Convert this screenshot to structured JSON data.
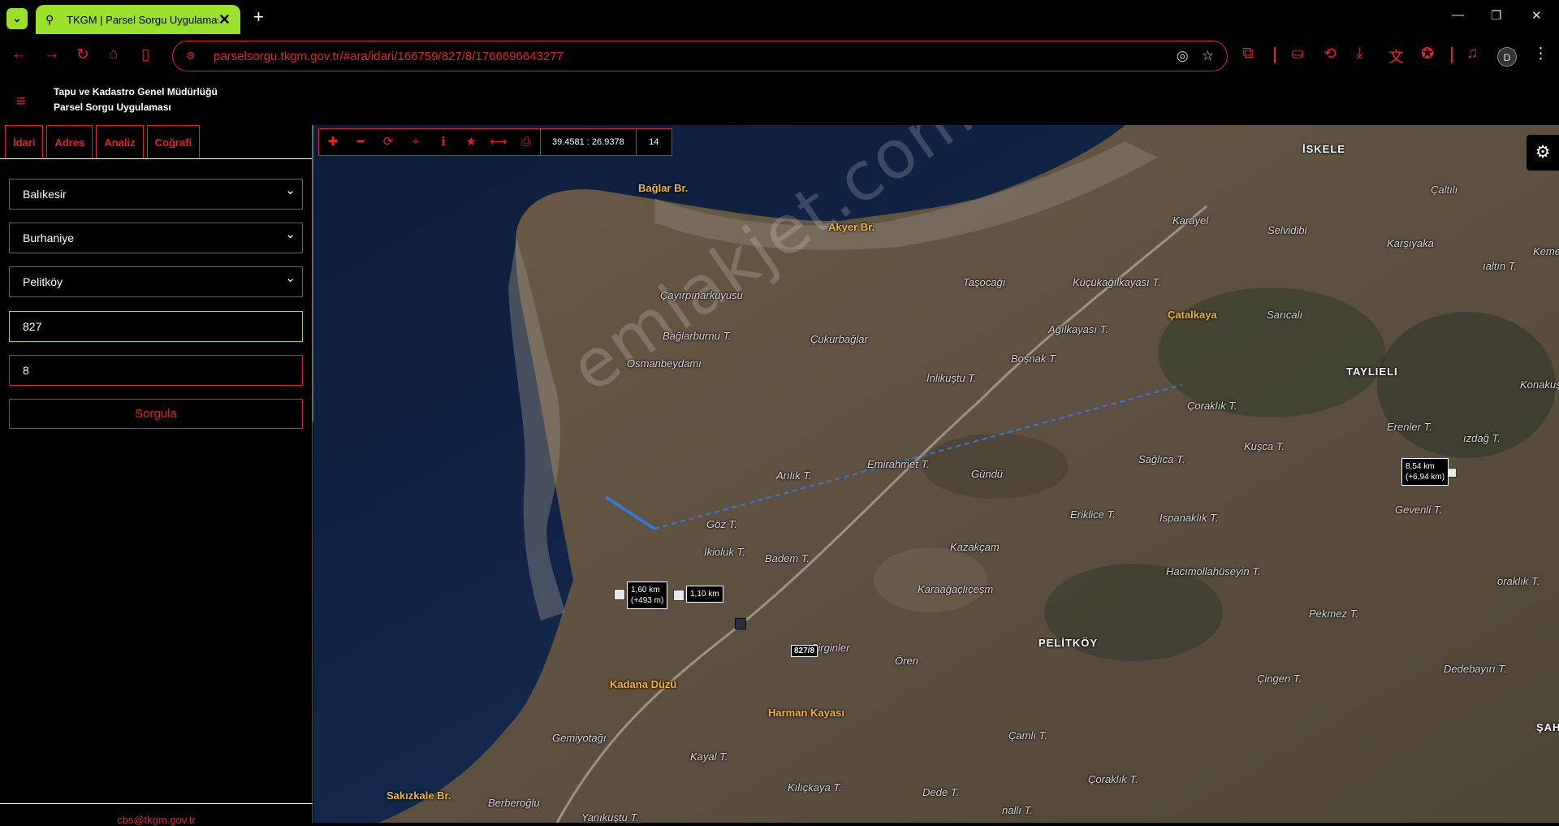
{
  "browser": {
    "tab_title": "TKGM | Parsel Sorgu Uygulaması",
    "url": "parselsorgu.tkgm.gov.tr/#ara/idari/166759/827/8/1766696643277"
  },
  "app": {
    "title_line1": "Tapu ve Kadastro Genel Müdürlüğü",
    "title_line2": "Parsel Sorgu Uygulaması"
  },
  "sidebar": {
    "tabs": [
      "İdari",
      "Adres",
      "Analiz",
      "Coğrafi"
    ],
    "province": "Balıkesir",
    "district": "Burhaniye",
    "neighborhood": "Pelitköy",
    "block": "827",
    "parcel": "8",
    "query_button": "Sorgula",
    "footer_email": "cbs@tkgm.gov.tr"
  },
  "map": {
    "coordinates": "39.4581 : 26.9378",
    "zoom": "14",
    "watermark": "emlakjet.com",
    "measurements": {
      "m1_line1": "1,60 km",
      "m1_line2": "(+493 m)",
      "m2": "1,10 km",
      "m3_line1": "8,54 km",
      "m3_line2": "(+6,94 km)",
      "parcel": "827/8"
    },
    "places": {
      "iskele": "İSKELE",
      "baglar_br": "Bağlar Br.",
      "akyer_br": "Akyer Br.",
      "catalkaya": "Çatalkaya",
      "taylieli": "TAYLIELI",
      "pelitkoy": "PELİTKÖY",
      "kadana_duzu": "Kadana Düzü",
      "harman_kayasi": "Harman Kayası",
      "sakizkale_br": "Sakızkale Br.",
      "caltili": "Çaltılı",
      "karayel": "Karayel",
      "selvidibi": "Selvidibi",
      "karsiyaka": "Karşıyaka",
      "altin_t": "ıaltın T.",
      "keme": "Keme",
      "tasocagi": "Taşocağı",
      "kucukagilkayasi": "Küçükağılkayası T.",
      "cayirpinarkuyusu": "Çayırpınarkuyusu",
      "baglarburnu": "Bağlarburnu T.",
      "cukurbaglar": "Çukurbağlar",
      "agilkayasi": "Ağılkayası T.",
      "saricali": "Sarıcalı",
      "osmanbeydami": "Osmanbeydamı",
      "inlikustu": "İnlikuştu T.",
      "bosnak": "Boşnak T.",
      "konakus": "Konakuş",
      "coraklik1": "Çoraklık T.",
      "erenler": "Erenler T.",
      "izdag": "ızdağ T.",
      "kusca": "Kuşca T.",
      "saglica": "Sağlıca T.",
      "emirahmet": "Emirahmet T.",
      "gundu": "Gündü",
      "arilik": "Arılık T.",
      "eriklice": "Eriklice T.",
      "ispanaklik": "Ispanaklık T.",
      "gevenli": "Gevenli T.",
      "goz": "Göz T.",
      "badem": "Badem T.",
      "kazakcam": "Kazakçam",
      "hacimollahuseyin": "Hacımollahüseyin T.",
      "oraklik": "oraklık T.",
      "ikioluk": "İkioluk T.",
      "karaagacliçesm": "Karaağaçlıçeşm",
      "pekmez": "Pekmez T.",
      "cirginler": "Cirginler",
      "oren": "Ören",
      "cingen": "Çingen T.",
      "dedebayiri": "Dedebayırı T.",
      "sah": "ŞAH",
      "gemiyotagi": "Gemiyotağı",
      "kayal": "Kayal T.",
      "camli": "Çamlı T.",
      "kilickaya": "Kılıçkaya T.",
      "dede": "Dede T.",
      "coraklik2": "Çoraklık T.",
      "berberoglu": "Berberoğlu",
      "yanikustu": "Yanıkuştu T.",
      "nalli": "nallı T."
    }
  }
}
